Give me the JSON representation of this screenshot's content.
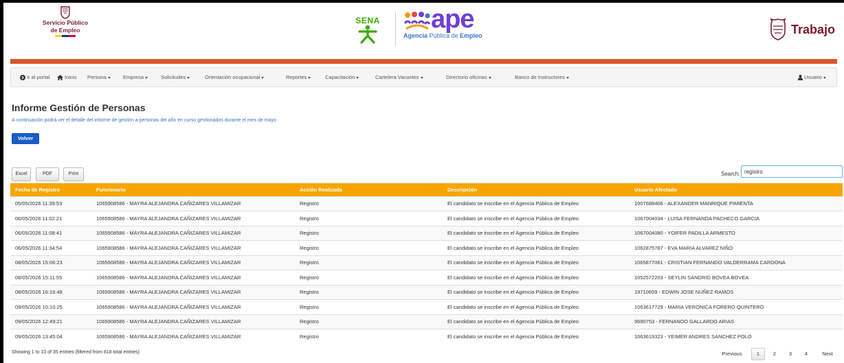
{
  "header": {
    "spe_text_line1": "Servicio Público",
    "spe_text_line2": "de Empleo",
    "sena_text": "SENA",
    "ape_text": "ape",
    "ape_sub_prefix": "Agencia",
    "ape_sub_middle": " Pública de ",
    "ape_sub_suffix": "Empleo",
    "trabajo_text": "Trabajo",
    "colors": {
      "brand_maroon": "#7a1a2a",
      "sena_green": "#39a900",
      "ape_purple": "#6f3ed6",
      "orange_bar": "#d9572a"
    }
  },
  "nav": {
    "ir_portal": "Ir al portal",
    "inicio": "Inicio",
    "persona": "Persona",
    "empresa": "Empresa",
    "solicitudes": "Solicitudes",
    "orientacion": "Orientación ocupacional",
    "reportes": "Reportes",
    "capacitacion": "Capacitación",
    "cartelera": "Cartelera Vacantes",
    "directorio": "Directorio oficinas",
    "banco": "Banco de Instructores",
    "usuario": "Usuario"
  },
  "page": {
    "title": "Informe Gestión de Personas",
    "description": "A continuación podrá ver el detalle del informe de gestión a personas del año en curso gestionados durante el mes de mayo",
    "volver": "Volver"
  },
  "export": {
    "excel": "Excel",
    "pdf": "PDF",
    "print": "Print"
  },
  "search": {
    "label": "Search:",
    "value": "registro"
  },
  "table": {
    "headers": [
      "Fecha de Registro",
      "Funcionario",
      "Acción Realizada",
      "Descripción",
      "Usuario Afectado"
    ],
    "header_color": "#f7a500",
    "rows": [
      [
        "05/05/2026 11:39:53",
        "1065908586 - MAYRA ALEJANDRA CAÑIZARES VILLAMIZAR",
        "Registro",
        "El candidato se inscribe en el Agencia Pública de Empleo",
        "1007688406 - ALEXANDER MANRIQUE PIMIENTA"
      ],
      [
        "06/05/2026 11:02:21",
        "1065908586 - MAYRA ALEJANDRA CAÑIZARES VILLAMIZAR",
        "Registro",
        "El candidato se inscribe en el Agencia Pública de Empleo",
        "1067004034 - LUISA FERNANDA PACHECO GARCIA"
      ],
      [
        "06/05/2026 11:08:41",
        "1065908586 - MAYRA ALEJANDRA CAÑIZARES VILLAMIZAR",
        "Registro",
        "El candidato se inscribe en el Agencia Pública de Empleo",
        "1067004080 - YOIFER PADILLA ARMESTO"
      ],
      [
        "06/05/2026 11:34:54",
        "1065908586 - MAYRA ALEJANDRA CAÑIZARES VILLAMIZAR",
        "Registro",
        "El candidato se inscribe en el Agencia Pública de Empleo",
        "1062875787 - EVA MARIA ALVAREZ NIÑO"
      ],
      [
        "08/05/2026 15:06:23",
        "1065908586 - MAYRA ALEJANDRA CAÑIZARES VILLAMIZAR",
        "Registro",
        "El candidato se inscribe en el Agencia Pública de Empleo",
        "1065877061 - CRISTIAN FERNANDO VALDERRAMA CARDONA"
      ],
      [
        "08/05/2026 15:11:55",
        "1065908586 - MAYRA ALEJANDRA CAÑIZARES VILLAMIZAR",
        "Registro",
        "El candidato se inscribe en el Agencia Pública de Empleo",
        "1052572203 - SEYLIN SANDRID BOVEA BOVEA"
      ],
      [
        "08/05/2026 16:16:48",
        "1065908586 - MAYRA ALEJANDRA CAÑIZARES VILLAMIZAR",
        "Registro",
        "El candidato se inscribe en el Agencia Pública de Empleo",
        "19710659 - EDWIN JOSE NUÑEZ RAMOS"
      ],
      [
        "09/05/2026 10:10:25",
        "1065908586 - MAYRA ALEJANDRA CAÑIZARES VILLAMIZAR",
        "Registro",
        "El candidato se inscribe en el Agencia Pública de Empleo",
        "1063617729 - MARIA VERONICA FORERO QUINTERO"
      ],
      [
        "09/05/2026 12:49:21",
        "1065908586 - MAYRA ALEJANDRA CAÑIZARES VILLAMIZAR",
        "Registro",
        "El candidato se inscribe en el Agencia Pública de Empleo",
        "9690753 - FERNANDO GALLARDO ARIAS"
      ],
      [
        "09/05/2026 13:45:04",
        "1065908586 - MAYRA ALEJANDRA CAÑIZARES VILLAMIZAR",
        "Registro",
        "El candidato se inscribe en el Agencia Pública de Empleo",
        "1063619323 - YEIMER ANDRES SANCHEZ POLO"
      ]
    ]
  },
  "footer": {
    "info": "Showing 1 to 10 of 35 entries (filtered from 818 total entries)",
    "previous": "Previous",
    "pages": [
      "1",
      "2",
      "3",
      "4"
    ],
    "next": "Next"
  }
}
